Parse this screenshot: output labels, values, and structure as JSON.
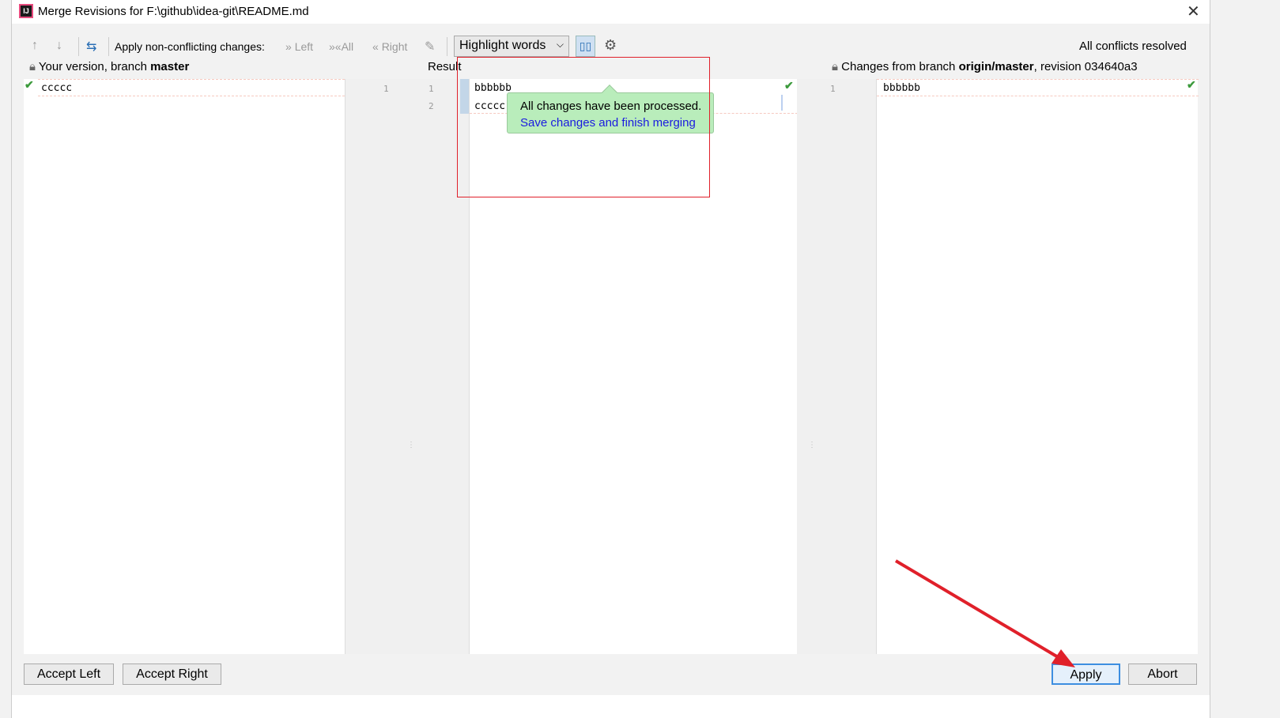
{
  "window": {
    "title": "Merge Revisions for F:\\github\\idea-git\\README.md",
    "icon": "intellij-icon"
  },
  "toolbar": {
    "apply_label": "Apply non-conflicting changes:",
    "left": "Left",
    "all": "All",
    "right": "Right",
    "highlight_mode": "Highlight words",
    "status": "All conflicts resolved"
  },
  "headers": {
    "left_prefix": "Your version, branch ",
    "left_branch": "master",
    "center": "Result",
    "right_prefix": "Changes from branch ",
    "right_branch": "origin/master",
    "right_suffix": ", revision 034640a3"
  },
  "left": {
    "lines": [
      {
        "num": "1",
        "text": "ccccc"
      }
    ]
  },
  "result": {
    "lines": [
      {
        "num": "1",
        "text": "bbbbbb"
      },
      {
        "num": "2",
        "text": "ccccc"
      }
    ]
  },
  "right": {
    "lines": [
      {
        "num": "1",
        "text": "bbbbbb"
      }
    ]
  },
  "tooltip": {
    "message": "All changes have been processed.",
    "link": "Save changes and finish merging"
  },
  "buttons": {
    "accept_left": "Accept Left",
    "accept_right": "Accept Right",
    "apply": "Apply",
    "abort": "Abort"
  },
  "colors": {
    "tooltip_bg": "#b9edbb",
    "link": "#1a1ae0",
    "annotation": "#e0202a",
    "accent": "#2a6fb5"
  }
}
